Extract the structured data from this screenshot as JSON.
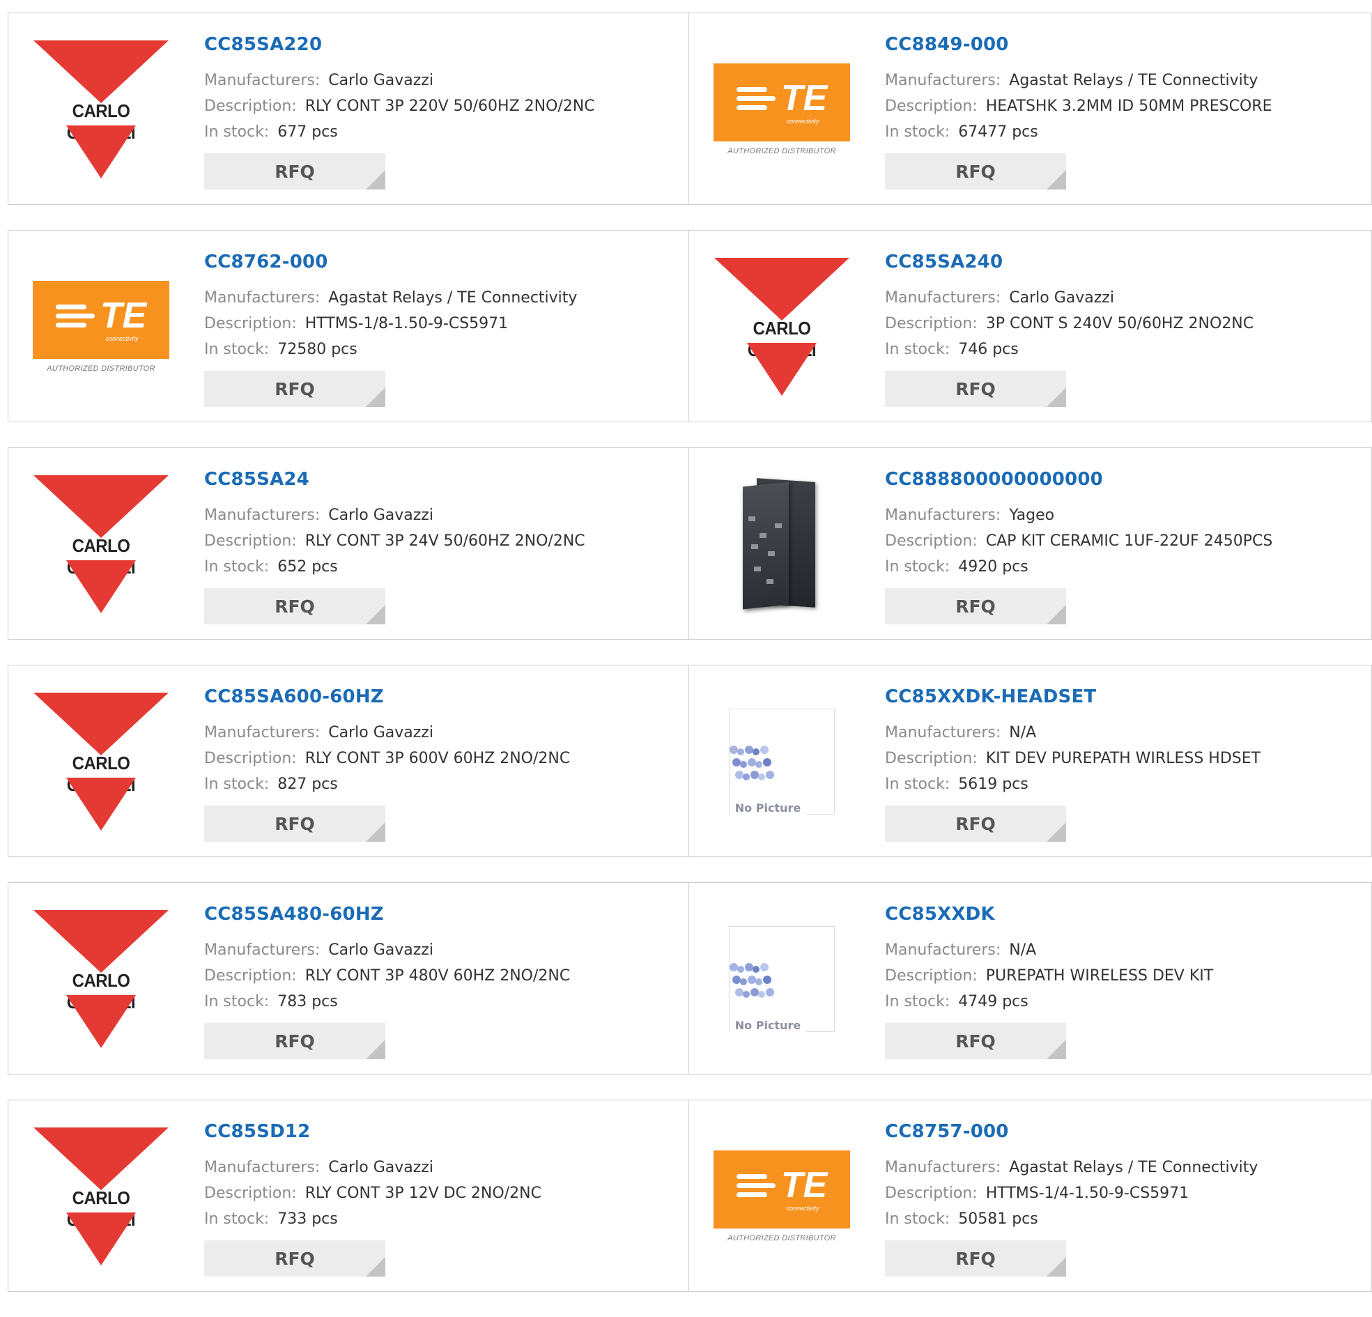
{
  "labels": {
    "manufacturers": "Manufacturers:",
    "description": "Description:",
    "in_stock": "In stock:",
    "rfq": "RFQ"
  },
  "logo_text": {
    "carlo_gavazzi": "CARLO GAVAZZI",
    "te_mark": "TE",
    "te_sub": "connectivity",
    "te_caption": "AUTHORIZED DISTRIBUTOR",
    "no_picture": "No Picture"
  },
  "colors": {
    "part_link": "#1b6bb6",
    "cg_red": "#e53a33",
    "te_orange": "#f7921e",
    "rfq_bg": "#ececec"
  },
  "products": [
    {
      "part": "CC85SA220",
      "manufacturer": "Carlo Gavazzi",
      "description": "RLY CONT 3P 220V 50/60HZ 2NO/2NC",
      "stock": "677 pcs",
      "logo": "carlo-gavazzi"
    },
    {
      "part": "CC8849-000",
      "manufacturer": "Agastat Relays / TE Connectivity",
      "description": "HEATSHK 3.2MM ID 50MM PRESCORE",
      "stock": "67477 pcs",
      "logo": "te-connectivity"
    },
    {
      "part": "CC8762-000",
      "manufacturer": "Agastat Relays / TE Connectivity",
      "description": "HTTMS-1/8-1.50-9-CS5971",
      "stock": "72580 pcs",
      "logo": "te-connectivity"
    },
    {
      "part": "CC85SA240",
      "manufacturer": "Carlo Gavazzi",
      "description": "3P CONT S 240V 50/60HZ 2NO2NC",
      "stock": "746 pcs",
      "logo": "carlo-gavazzi"
    },
    {
      "part": "CC85SA24",
      "manufacturer": "Carlo Gavazzi",
      "description": "RLY CONT 3P 24V 50/60HZ 2NO/2NC",
      "stock": "652 pcs",
      "logo": "carlo-gavazzi"
    },
    {
      "part": "CC888800000000000",
      "manufacturer": "Yageo",
      "description": "CAP KIT CERAMIC 1UF-22UF 2450PCS",
      "stock": "4920 pcs",
      "logo": "product-photo"
    },
    {
      "part": "CC85SA600-60HZ",
      "manufacturer": "Carlo Gavazzi",
      "description": "RLY CONT 3P 600V 60HZ 2NO/2NC",
      "stock": "827 pcs",
      "logo": "carlo-gavazzi"
    },
    {
      "part": "CC85XXDK-HEADSET",
      "manufacturer": "N/A",
      "description": "KIT DEV PUREPATH WIRLESS HDSET",
      "stock": "5619 pcs",
      "logo": "no-picture"
    },
    {
      "part": "CC85SA480-60HZ",
      "manufacturer": "Carlo Gavazzi",
      "description": "RLY CONT 3P 480V 60HZ 2NO/2NC",
      "stock": "783 pcs",
      "logo": "carlo-gavazzi"
    },
    {
      "part": "CC85XXDK",
      "manufacturer": "N/A",
      "description": "PUREPATH WIRELESS DEV KIT",
      "stock": "4749 pcs",
      "logo": "no-picture"
    },
    {
      "part": "CC85SD12",
      "manufacturer": "Carlo Gavazzi",
      "description": "RLY CONT 3P 12V DC 2NO/2NC",
      "stock": "733 pcs",
      "logo": "carlo-gavazzi"
    },
    {
      "part": "CC8757-000",
      "manufacturer": "Agastat Relays / TE Connectivity",
      "description": "HTTMS-1/4-1.50-9-CS5971",
      "stock": "50581 pcs",
      "logo": "te-connectivity"
    }
  ]
}
